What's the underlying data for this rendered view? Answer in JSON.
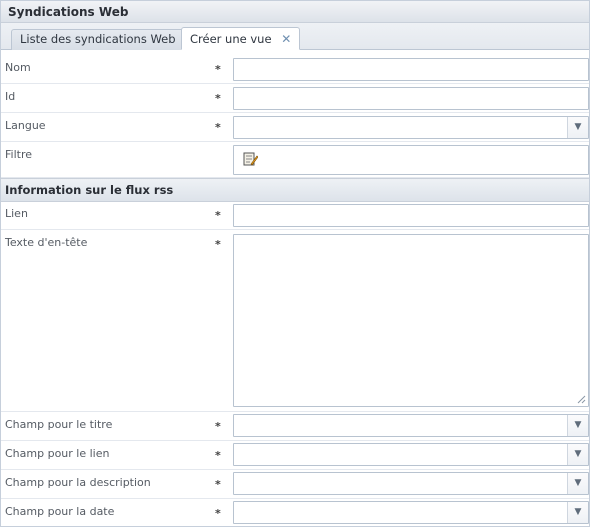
{
  "window": {
    "title": "Syndications Web"
  },
  "tabs": [
    {
      "label": "Liste des syndications Web"
    },
    {
      "label": "Créer une vue",
      "close_icon": "close-icon"
    }
  ],
  "form": {
    "nom": {
      "label": "Nom",
      "required": "*",
      "value": ""
    },
    "id": {
      "label": "Id",
      "required": "*",
      "value": ""
    },
    "langue": {
      "label": "Langue",
      "required": "*",
      "value": ""
    },
    "filtre": {
      "label": "Filtre",
      "icon": "edit-filter-icon"
    }
  },
  "section_rss": {
    "title": "Information sur le flux rss",
    "lien": {
      "label": "Lien",
      "required": "*",
      "value": ""
    },
    "entete": {
      "label": "Texte d'en-tête",
      "required": "*",
      "value": ""
    },
    "champ_titre": {
      "label": "Champ pour le titre",
      "required": "*",
      "value": ""
    },
    "champ_lien": {
      "label": "Champ pour le lien",
      "required": "*",
      "value": ""
    },
    "champ_description": {
      "label": "Champ pour la description",
      "required": "*",
      "value": ""
    },
    "champ_date": {
      "label": "Champ pour la date",
      "required": "*",
      "value": ""
    }
  },
  "colors": {
    "border": "#b8c3d0",
    "header_bg": "#dde3ea",
    "tab_close": "#6f8fb0"
  }
}
